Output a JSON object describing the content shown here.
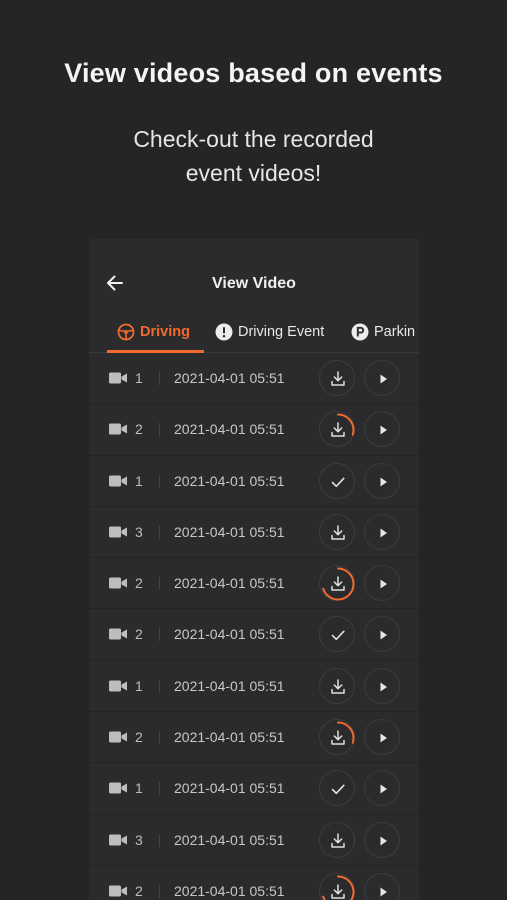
{
  "promo": {
    "title": "View videos based on events",
    "subtitle_line1": "Check-out the recorded",
    "subtitle_line2": "event videos!"
  },
  "app": {
    "title": "View Video",
    "accent_color": "#f26a2e",
    "tabs": [
      {
        "label": "Driving",
        "icon": "driving-icon",
        "active": true
      },
      {
        "label": "Driving Event",
        "icon": "alert-icon",
        "active": false
      },
      {
        "label": "Parkin",
        "icon": "parking-icon",
        "active": false
      }
    ],
    "videos": [
      {
        "channel": "1",
        "timestamp": "2021-04-01 05:51",
        "status": "download",
        "progress": 0
      },
      {
        "channel": "2",
        "timestamp": "2021-04-01 05:51",
        "status": "downloading",
        "progress": 0.3
      },
      {
        "channel": "1",
        "timestamp": "2021-04-01 05:51",
        "status": "downloaded",
        "progress": 1
      },
      {
        "channel": "3",
        "timestamp": "2021-04-01 05:51",
        "status": "download",
        "progress": 0
      },
      {
        "channel": "2",
        "timestamp": "2021-04-01 05:51",
        "status": "downloading",
        "progress": 0.7
      },
      {
        "channel": "2",
        "timestamp": "2021-04-01 05:51",
        "status": "downloaded",
        "progress": 1
      },
      {
        "channel": "1",
        "timestamp": "2021-04-01 05:51",
        "status": "download",
        "progress": 0
      },
      {
        "channel": "2",
        "timestamp": "2021-04-01 05:51",
        "status": "downloading",
        "progress": 0.3
      },
      {
        "channel": "1",
        "timestamp": "2021-04-01 05:51",
        "status": "downloaded",
        "progress": 1
      },
      {
        "channel": "3",
        "timestamp": "2021-04-01 05:51",
        "status": "download",
        "progress": 0
      },
      {
        "channel": "2",
        "timestamp": "2021-04-01 05:51",
        "status": "downloading",
        "progress": 0.7
      }
    ]
  }
}
